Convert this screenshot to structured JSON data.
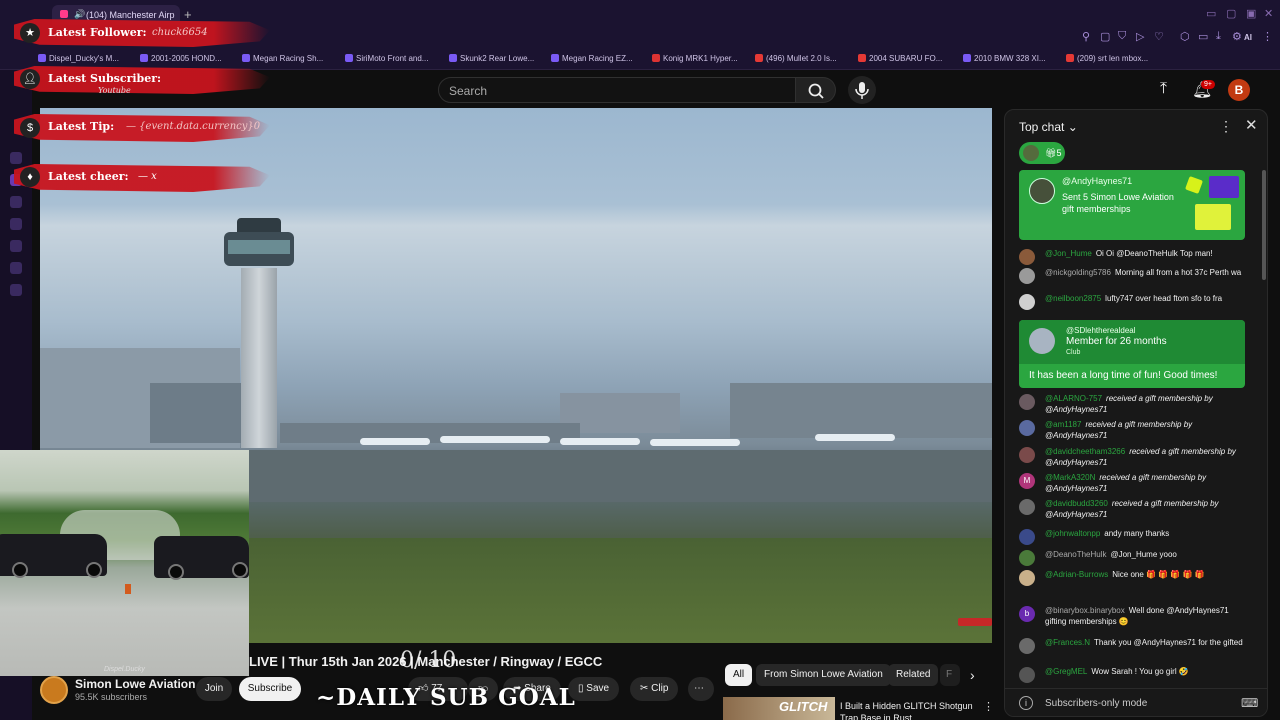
{
  "browser": {
    "tab_title": "(104) Manchester Airp",
    "new_tab": "+",
    "bookmarks": [
      {
        "label": "Dispel_Ducky's M...",
        "color": "#7a5af5"
      },
      {
        "label": "2001-2005 HOND...",
        "color": "#7a5af5"
      },
      {
        "label": "Megan Racing Sh...",
        "color": "#7a5af5"
      },
      {
        "label": "SiriMoto Front and...",
        "color": "#7a5af5"
      },
      {
        "label": "Skunk2 Rear Lowe...",
        "color": "#7a5af5"
      },
      {
        "label": "Megan Racing EZ...",
        "color": "#7a5af5"
      },
      {
        "label": "Konig MRK1 Hyper...",
        "color": "#d33"
      },
      {
        "label": "(496) Mullet 2.0 Is...",
        "color": "#e53935"
      },
      {
        "label": "2004 SUBARU FO...",
        "color": "#e53935"
      },
      {
        "label": "2010 BMW 328 XI...",
        "color": "#7a5af5"
      },
      {
        "label": "(209) srt len mbox...",
        "color": "#e53935"
      }
    ],
    "extensions_label": "AI"
  },
  "overlay": {
    "latest_follower_label": "Latest Follower:",
    "latest_follower_value": "chuck6654",
    "latest_subscriber_label": "Latest Subscriber:",
    "latest_subscriber_value": "Youtube",
    "latest_tip_label": "Latest Tip:",
    "latest_tip_value": "— {event.data.currency}0",
    "latest_cheer_label": "Latest cheer:",
    "latest_cheer_value": "— x",
    "sub_goal_count": "0/ 10",
    "sub_goal_label": "~DAILY SUB GOAL"
  },
  "header": {
    "search_placeholder": "Search",
    "notif_count": "9+",
    "avatar_letter": "B"
  },
  "video": {
    "title": "LIVE | Thur 15th Jan 2026 | Manchester / Ringway / EGCC",
    "pip_label": "Dispel.Ducky"
  },
  "channel": {
    "name": "Simon Lowe Aviation",
    "subs": "95.5K subscribers",
    "join": "Join",
    "subscribe": "Subscribe"
  },
  "actions": {
    "likes": "77",
    "share": "Share",
    "save": "Save",
    "clip": "Clip",
    "more": "⋯"
  },
  "chips": {
    "all": "All",
    "from_channel": "From Simon Lowe Aviation",
    "related": "Related",
    "next": "F"
  },
  "recommended": {
    "thumb_text": "GLITCH",
    "title": "I Built a Hidden GLITCH Shotgun Trap Base in Rust"
  },
  "chat": {
    "mode": "Top chat",
    "gift_count": "5",
    "gift_card": {
      "user": "@AndyHaynes71",
      "text": "Sent 5 Simon Lowe Aviation gift memberships"
    },
    "member_card": {
      "user": "@SDlehtherealdeal",
      "months": "Member for 26 months",
      "club": "Club",
      "message": "It has been a long time of fun! Good times!"
    },
    "messages_top": [
      {
        "user": "@Jon_Hume",
        "text": "Oi Oi @DeanoTheHulk Top man!",
        "color": "#8a5a3a",
        "initial": "",
        "user_grey": false
      },
      {
        "user": "@nickgolding5786",
        "text": "Morning all from a hot 37c Perth wa",
        "color": "#9a9a9a",
        "initial": "",
        "user_grey": true
      },
      {
        "user": "@neilboon2875",
        "text": "lufty747 over head ftom sfo to fra",
        "color": "#cfcfcf",
        "initial": "",
        "user_grey": false
      }
    ],
    "messages_bottom": [
      {
        "user": "@ALARNO-757",
        "text": "received a gift membership by @AndyHaynes71",
        "color": "#6a5a60",
        "initial": "",
        "gift": true
      },
      {
        "user": "@am1187",
        "text": "received a gift membership by @AndyHaynes71",
        "color": "#5a6aa0",
        "initial": "",
        "gift": true
      },
      {
        "user": "@davidcheetham3266",
        "text": "received a gift membership by @AndyHaynes71",
        "color": "#7a4a4a",
        "initial": "",
        "gift": true
      },
      {
        "user": "@MarkA320N",
        "text": "received a gift membership by @AndyHaynes71",
        "color": "#b0357a",
        "initial": "M",
        "gift": true
      },
      {
        "user": "@davidbudd3260",
        "text": "received a gift membership by @AndyHaynes71",
        "color": "#6a6a6a",
        "initial": "",
        "gift": true
      },
      {
        "user": "@johnwaltonpp",
        "text": "andy many thanks",
        "color": "#3a4a8a",
        "initial": "",
        "gift": false
      },
      {
        "user": "@DeanoTheHulk",
        "text": "@Jon_Hume yooo",
        "color": "#4a7a3a",
        "initial": "",
        "gift": false,
        "user_grey": true
      },
      {
        "user": "@Adrian-Burrows",
        "text": "Nice one 🎁 🎁 🎁 🎁 🎁",
        "color": "#c9b08a",
        "initial": "",
        "gift": false
      },
      {
        "user": "@binarybox.binarybox",
        "text": "Well done @AndyHaynes71 gifting memberships 😊",
        "color": "#6a2ab0",
        "initial": "b",
        "gift": false,
        "user_grey": true
      },
      {
        "user": "@Frances.N",
        "text": "Thank you @AndyHaynes71 for the gifted",
        "color": "#6a6a6a",
        "initial": "",
        "gift": false
      },
      {
        "user": "@GregMEL",
        "text": "Wow Sarah ! You go girl 🤣",
        "color": "#555",
        "initial": "",
        "gift": false
      }
    ],
    "footer": "Subscribers-only mode"
  }
}
